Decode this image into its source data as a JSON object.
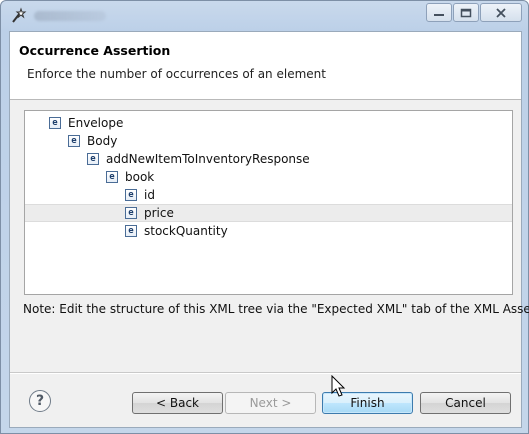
{
  "window": {
    "icons": {
      "app": "wizard-icon",
      "minimize": "minimize-icon",
      "maximize": "maximize-icon",
      "close": "close-icon"
    }
  },
  "header": {
    "title": "Occurrence Assertion",
    "description": "Enforce the number of occurrences of an element"
  },
  "tree": {
    "icon_label": "e",
    "nodes": [
      {
        "label": "Envelope",
        "depth": 0,
        "selected": false
      },
      {
        "label": "Body",
        "depth": 1,
        "selected": false
      },
      {
        "label": "addNewItemToInventoryResponse",
        "depth": 2,
        "selected": false
      },
      {
        "label": "book",
        "depth": 3,
        "selected": false
      },
      {
        "label": "id",
        "depth": 4,
        "selected": false
      },
      {
        "label": "price",
        "depth": 4,
        "selected": true
      },
      {
        "label": "stockQuantity",
        "depth": 4,
        "selected": false
      }
    ]
  },
  "note": "Note: Edit the structure of this XML tree via the \"Expected XML\" tab of the XML Assertor.",
  "buttons": {
    "help_symbol": "?",
    "back": "< Back",
    "next": "Next >",
    "finish": "Finish",
    "cancel": "Cancel"
  },
  "colors": {
    "accent": "#3d7bad",
    "selected_row": "#ececec",
    "panel": "#f0f0f0"
  }
}
